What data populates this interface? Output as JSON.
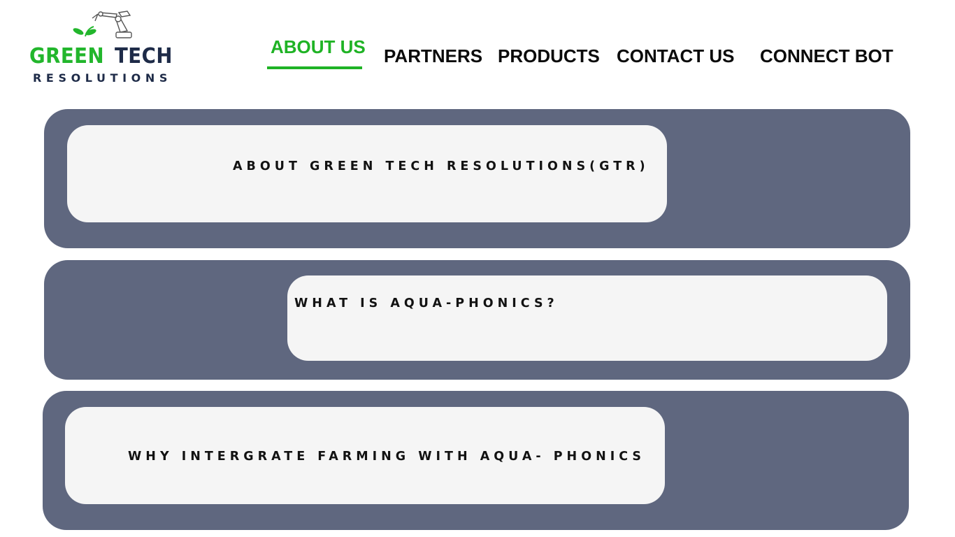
{
  "logo": {
    "word_green": "GREEN",
    "word_dark": "TECH",
    "subtitle": "RESOLUTIONS",
    "icon": "robot-arm-sprout-icon",
    "colors": {
      "green": "#22b62c",
      "navy": "#1e2b48"
    }
  },
  "nav": {
    "items": [
      {
        "label": "ABOUT US",
        "active": true
      },
      {
        "label": "PARTNERS",
        "active": false
      },
      {
        "label": "PRODUCTS",
        "active": false
      },
      {
        "label": "CONTACT US",
        "active": false
      },
      {
        "label": "CONNECT BOT",
        "active": false
      }
    ],
    "active_color": "#1fb325"
  },
  "sections": [
    {
      "title": "ABOUT GREEN TECH RESOLUTIONS(GTR)"
    },
    {
      "title": "WHAT IS AQUA-PHONICS?"
    },
    {
      "title": "WHY INTERGRATE FARMING WITH AQUA- PHONICS"
    }
  ],
  "colors": {
    "panel": "#5f677f",
    "card": "#f5f5f5",
    "text": "#121212"
  }
}
